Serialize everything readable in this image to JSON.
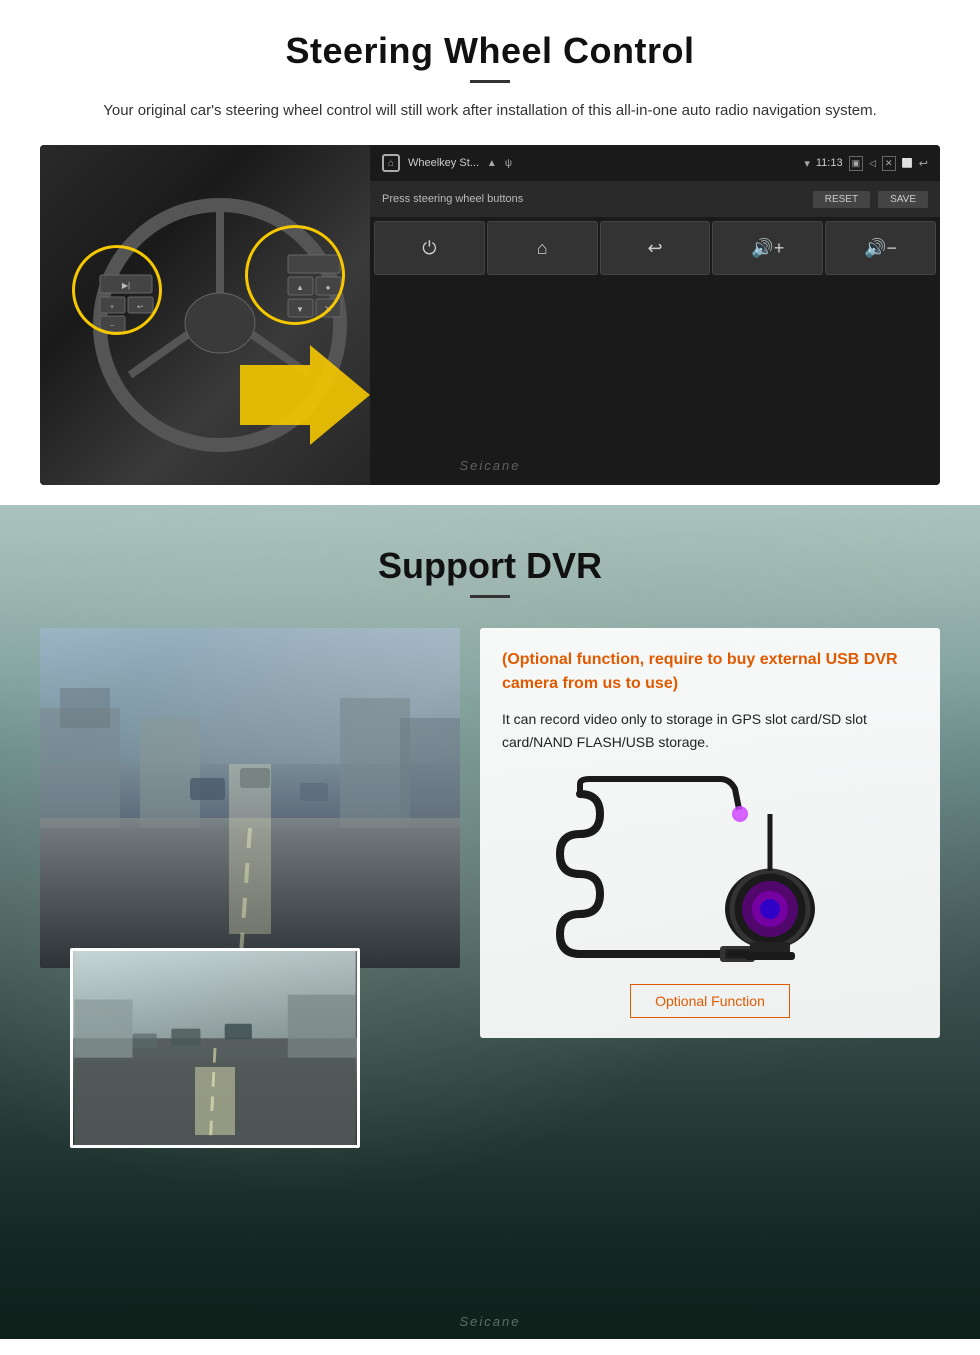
{
  "page": {
    "steering_section": {
      "title": "Steering Wheel Control",
      "subtitle": "Your original car's steering wheel control will still work after installation of this all-in-one auto radio navigation system.",
      "android_screen": {
        "app_title": "Wheelkey St...",
        "time": "11:13",
        "instruction": "Press steering wheel buttons",
        "reset_btn": "RESET",
        "save_btn": "SAVE",
        "buttons": [
          "⏻",
          "⌂",
          "↩",
          "🔊+",
          "🔊-"
        ]
      },
      "watermark": "Seicane"
    },
    "dvr_section": {
      "title": "Support DVR",
      "optional_text": "(Optional function, require to buy external USB DVR camera from us to use)",
      "desc_text": "It can record video only to storage in GPS slot card/SD slot card/NAND FLASH/USB storage.",
      "optional_badge": "Optional Function",
      "watermark": "Seicane"
    }
  }
}
